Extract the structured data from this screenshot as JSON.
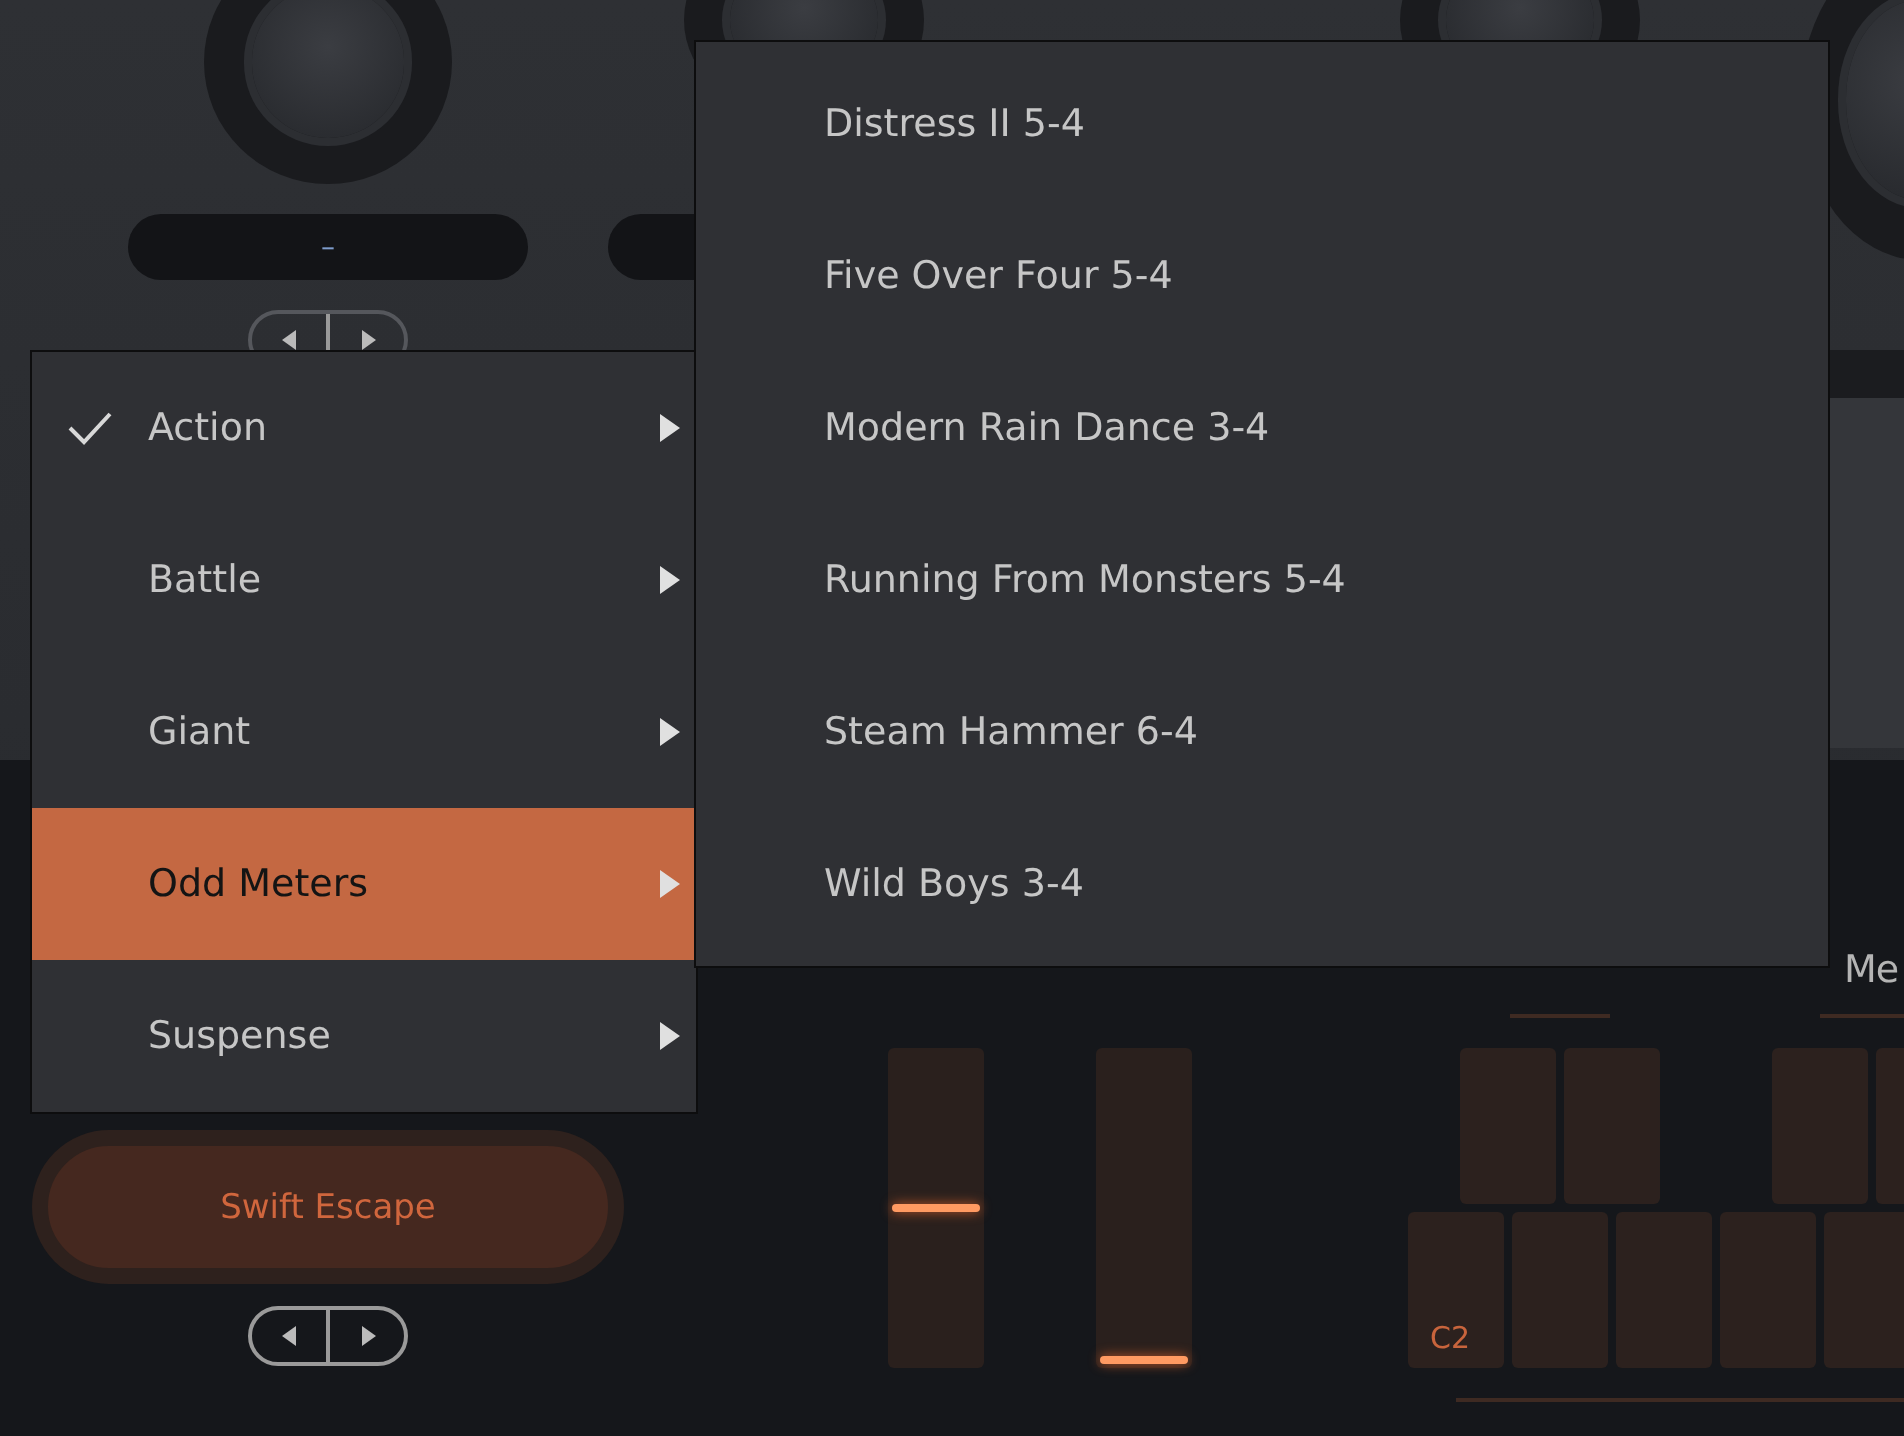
{
  "top_panel": {
    "value_display": "–"
  },
  "category_menu": [
    {
      "label": "Action",
      "checked": true,
      "selected": false
    },
    {
      "label": "Battle",
      "checked": false,
      "selected": false
    },
    {
      "label": "Giant",
      "checked": false,
      "selected": false
    },
    {
      "label": "Odd Meters",
      "checked": false,
      "selected": true
    },
    {
      "label": "Suspense",
      "checked": false,
      "selected": false
    }
  ],
  "submenu": [
    {
      "label": "Distress II 5-4"
    },
    {
      "label": "Five Over Four 5-4"
    },
    {
      "label": "Modern Rain Dance 3-4"
    },
    {
      "label": "Running From Monsters 5-4"
    },
    {
      "label": "Steam Hammer 6-4"
    },
    {
      "label": "Wild Boys 3-4"
    }
  ],
  "preset_button": {
    "label": "Swift Escape"
  },
  "sliders": [
    {
      "level": 0.5
    },
    {
      "level": 0.0
    }
  ],
  "pad_groups": [
    {
      "label": "Me"
    }
  ],
  "pads": {
    "first_pad_note": "C2"
  }
}
